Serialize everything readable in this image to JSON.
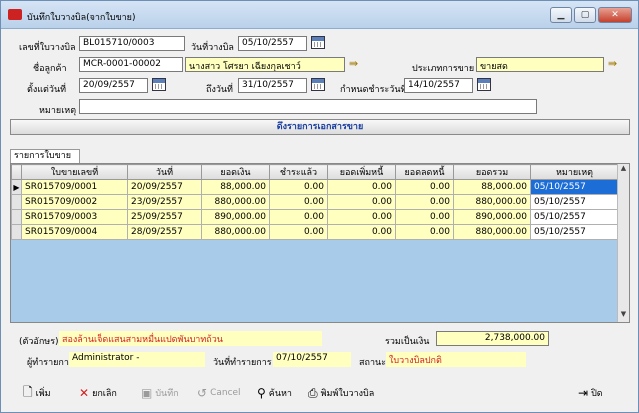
{
  "window": {
    "title": "บันทึกใบวางบิล(จากใบขาย)"
  },
  "header": {
    "bill_no_label": "เลขที่ใบวางบิล",
    "bill_no": "BL015710/0003",
    "bill_date_label": "วันที่วางบิล",
    "bill_date": "05/10/2557",
    "customer_label": "ชื่อลูกค้า",
    "customer_code": "MCR-0001-00002",
    "customer_name": "นางสาว โศรยา เฉียงกุลเชาว์",
    "sale_type_label": "ประเภทการขาย",
    "sale_type": "ขายสด",
    "from_date_label": "ตั้งแต่วันที่",
    "from_date": "20/09/2557",
    "to_date_label": "ถึงวันที่",
    "to_date": "31/10/2557",
    "due_date_label": "กำหนดชำระวันที่",
    "due_date": "14/10/2557",
    "note_label": "หมายเหตุ",
    "note": ""
  },
  "fetch_button": "ดึงรายการเอกสารขาย",
  "tab_label": "รายการใบขาย",
  "grid": {
    "columns": [
      "ใบขายเลขที่",
      "วันที่",
      "ยอดเงิน",
      "ชำระแล้ว",
      "ยอดเพิ่มหนี้",
      "ยอดลดหนี้",
      "ยอดรวม",
      "หมายเหตุ"
    ],
    "rows": [
      {
        "no": "SR015709/0001",
        "date": "20/09/2557",
        "amount": "88,000.00",
        "paid": "0.00",
        "debit": "0.00",
        "credit": "0.00",
        "total": "88,000.00",
        "note": "05/10/2557"
      },
      {
        "no": "SR015709/0002",
        "date": "23/09/2557",
        "amount": "880,000.00",
        "paid": "0.00",
        "debit": "0.00",
        "credit": "0.00",
        "total": "880,000.00",
        "note": "05/10/2557"
      },
      {
        "no": "SR015709/0003",
        "date": "25/09/2557",
        "amount": "890,000.00",
        "paid": "0.00",
        "debit": "0.00",
        "credit": "0.00",
        "total": "890,000.00",
        "note": "05/10/2557"
      },
      {
        "no": "SR015709/0004",
        "date": "28/09/2557",
        "amount": "880,000.00",
        "paid": "0.00",
        "debit": "0.00",
        "credit": "0.00",
        "total": "880,000.00",
        "note": "05/10/2557"
      }
    ]
  },
  "footer": {
    "text_amount_label": "(ตัวอักษร)",
    "text_amount": "สองล้านเจ็ดแสนสามหมื่นแปดพันบาทถ้วน",
    "total_label": "รวมเป็นเงิน",
    "total": "2,738,000.00",
    "operator_label": "ผู้ทำรายการ",
    "operator": "Administrator -",
    "op_date_label": "วันที่ทำรายการ",
    "op_date": "07/10/2557",
    "status_label": "สถานะ",
    "status": "ใบวางบิลปกติ"
  },
  "toolbar": {
    "add": "เพิ่ม",
    "cancel_doc": "ยกเลิก",
    "save": "บันทึก",
    "cancel": "Cancel",
    "search": "ค้นหา",
    "print": "พิมพ์ใบวางบิล",
    "close": "ปิด"
  },
  "colors": {
    "yellow_field": "#ffffc0",
    "grid_bg": "#a8cbea",
    "selection": "#1c6ed6",
    "status_red": "#d42020"
  }
}
